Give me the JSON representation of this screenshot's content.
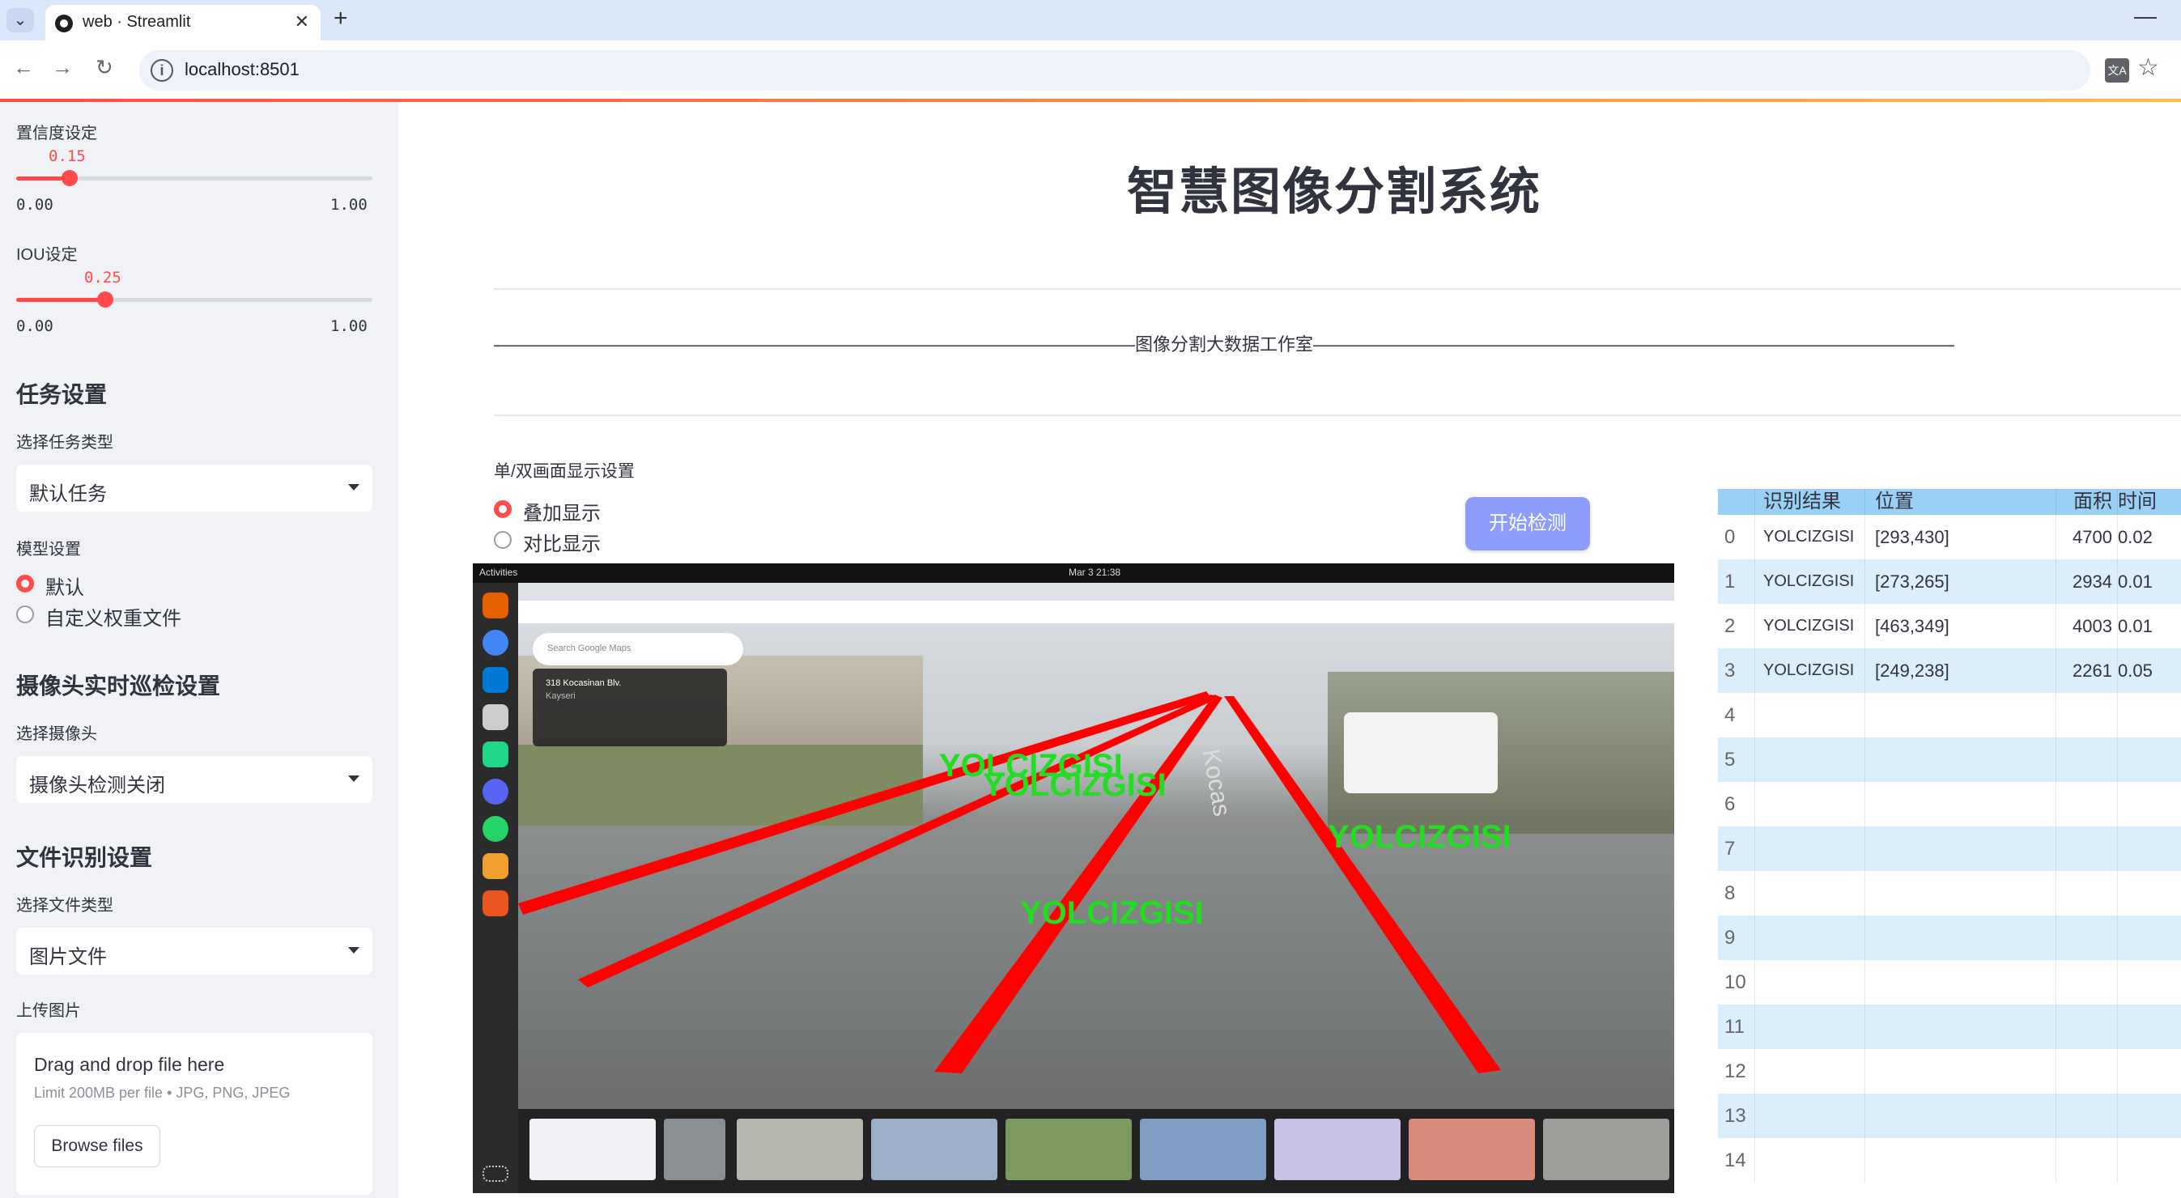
{
  "browser": {
    "tab_title": "web · Streamlit",
    "url": "localhost:8501",
    "icons": {
      "dropdown": "chevron-down-icon",
      "close": "close-icon",
      "new_tab": "plus-icon",
      "back": "back-arrow-icon",
      "forward": "forward-arrow-icon",
      "reload": "reload-icon",
      "site_info": "info-icon",
      "translate": "translate-icon",
      "bookmark": "star-icon",
      "minimize": "minimize-icon"
    }
  },
  "sidebar": {
    "confidence": {
      "label": "置信度设定",
      "value": "0.15",
      "min": "0.00",
      "max": "1.00",
      "fraction": 0.15
    },
    "iou": {
      "label": "IOU设定",
      "value": "0.25",
      "min": "0.00",
      "max": "1.00",
      "fraction": 0.25
    },
    "task_header": "任务设置",
    "task_type_label": "选择任务类型",
    "task_type_value": "默认任务",
    "model_label": "模型设置",
    "model_options": [
      "默认",
      "自定义权重文件"
    ],
    "model_selected": 0,
    "camera_header": "摄像头实时巡检设置",
    "camera_label": "选择摄像头",
    "camera_value": "摄像头检测关闭",
    "file_header": "文件识别设置",
    "file_type_label": "选择文件类型",
    "file_type_value": "图片文件",
    "upload_label": "上传图片",
    "uploader": {
      "title": "Drag and drop file here",
      "limit": "Limit 200MB per file • JPG, PNG, JPEG",
      "button": "Browse files"
    }
  },
  "main": {
    "title": "智慧图像分割系统",
    "studio_line": "————————————————————————————————————图像分割大数据工作室————————————————————————————————————",
    "display_mode_label": "单/双画面显示设置",
    "display_options": [
      "叠加显示",
      "对比显示"
    ],
    "display_selected": 0,
    "detect_button": "开始检测",
    "detections": [
      {
        "label": "YOLCIZGISI"
      },
      {
        "label": "YOLCIZGISI"
      },
      {
        "label": "YOLCIZGISI"
      },
      {
        "label": "YOLCIZGISI"
      }
    ],
    "street_sign": "Kocas",
    "screen_clock": "Mar 3  21:38",
    "map_card": {
      "title": "318 Kocasinan Blv.",
      "subtitle": "Kayseri"
    },
    "search_placeholder": "Search Google Maps",
    "dock_activities": "Activities"
  },
  "table": {
    "columns": [
      "",
      "识别结果",
      "位置",
      "面积",
      "时间"
    ],
    "rows": [
      [
        "0",
        "YOLCIZGISI",
        "[293,430]",
        "4700",
        "0.02"
      ],
      [
        "1",
        "YOLCIZGISI",
        "[273,265]",
        "2934",
        "0.01"
      ],
      [
        "2",
        "YOLCIZGISI",
        "[463,349]",
        "4003",
        "0.01"
      ],
      [
        "3",
        "YOLCIZGISI",
        "[249,238]",
        "2261",
        "0.05"
      ],
      [
        "4",
        "",
        "",
        "",
        ""
      ],
      [
        "5",
        "",
        "",
        "",
        ""
      ],
      [
        "6",
        "",
        "",
        "",
        ""
      ],
      [
        "7",
        "",
        "",
        "",
        ""
      ],
      [
        "8",
        "",
        "",
        "",
        ""
      ],
      [
        "9",
        "",
        "",
        "",
        ""
      ],
      [
        "10",
        "",
        "",
        "",
        ""
      ],
      [
        "11",
        "",
        "",
        "",
        ""
      ],
      [
        "12",
        "",
        "",
        "",
        ""
      ],
      [
        "13",
        "",
        "",
        "",
        ""
      ],
      [
        "14",
        "",
        "",
        "",
        ""
      ]
    ]
  },
  "colors": {
    "accent": "#ff4b4b",
    "button": "#8c9dfb",
    "table_header": "#9bd0f5",
    "table_stripe": "#dbeefb",
    "overlay_line": "#ff0000",
    "overlay_text": "#22dd22"
  }
}
